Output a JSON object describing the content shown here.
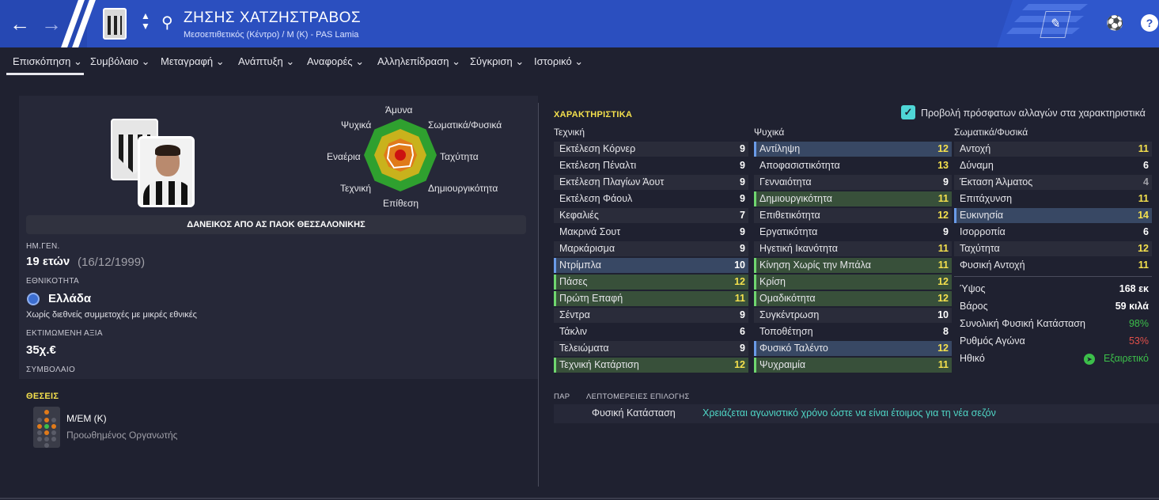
{
  "header": {
    "player_name": "ΖΗΣΗΣ ΧΑΤΖΗΣΤΡΑΒΟΣ",
    "player_sub": "Μεσοεπιθετικός (Κέντρο) / Μ (Κ) - PAS Lamia",
    "back_icon": "arrow-left-icon",
    "forward_icon": "arrow-right-icon",
    "search_icon": "search-icon",
    "help_label": "?"
  },
  "menu": {
    "items": [
      {
        "label": "Επισκόπηση"
      },
      {
        "label": "Συμβόλαιο"
      },
      {
        "label": "Μεταγραφή"
      },
      {
        "label": "Ανάπτυξη"
      },
      {
        "label": "Αναφορές"
      },
      {
        "label": "Αλληλεπίδραση"
      },
      {
        "label": "Σύγκριση"
      },
      {
        "label": "Ιστορικό"
      }
    ],
    "chevron": "⌄"
  },
  "radar": {
    "labels": [
      "Άμυνα",
      "Σωματικά/Φυσικά",
      "Ταχύτητα",
      "Δημιουργικότητα",
      "Επίθεση",
      "Τεχνική",
      "Εναέρια",
      "Ψυχικά"
    ],
    "colors": {
      "outer": "#2fa02f",
      "mid": "#c9b21c",
      "inner": "#e07a1a",
      "core": "#cc1111"
    }
  },
  "profile": {
    "loan_text": "ΔΑΝΕΙΚΟΣ ΑΠΟ ΑΣ ΠΑΟΚ ΘΕΣΣΑΛΟΝΙΚΗΣ",
    "dob_label": "ΗΜ.ΓΕΝ.",
    "age": "19 ετών",
    "dob": "(16/12/1999)",
    "nationality_label": "ΕΘΝΙΚΟΤΗΤΑ",
    "nationality": "Ελλάδα",
    "caps_note": "Χωρίς διεθνείς συμμετοχές με μικρές εθνικές",
    "value_label": "ΕΚΤΙΜΩΜΕΝΗ ΑΞΙΑ",
    "value": "35χ.€",
    "contract_label": "ΣΥΜΒΟΛΑΙΟ"
  },
  "positions": {
    "title": "ΘΕΣΕΙΣ",
    "position": "Μ/ΕΜ (Κ)",
    "role": "Προωθημένος Οργανωτής"
  },
  "attributes": {
    "title": "ΧΑΡΑΚΤΗΡΙΣΤΙΚΑ",
    "checkbox_label": "Προβολή πρόσφατων αλλαγών στα χαρακτηριστικά",
    "checkbox_mark": "✓",
    "col_technical": "Τεχνική",
    "col_mental": "Ψυχικά",
    "col_physical": "Σωματικά/Φυσικά",
    "technical": [
      {
        "name": "Εκτέλεση Κόρνερ",
        "value": "9",
        "hl": ""
      },
      {
        "name": "Εκτέλεση Πέναλτι",
        "value": "9",
        "hl": ""
      },
      {
        "name": "Εκτέλεση Πλαγίων Άουτ",
        "value": "9",
        "hl": ""
      },
      {
        "name": "Εκτέλεση Φάουλ",
        "value": "9",
        "hl": ""
      },
      {
        "name": "Κεφαλιές",
        "value": "7",
        "hl": ""
      },
      {
        "name": "Μακρινά Σουτ",
        "value": "9",
        "hl": ""
      },
      {
        "name": "Μαρκάρισμα",
        "value": "9",
        "hl": ""
      },
      {
        "name": "Ντρίμπλα",
        "value": "10",
        "hl": "blue"
      },
      {
        "name": "Πάσες",
        "value": "12",
        "hl": "green"
      },
      {
        "name": "Πρώτη Επαφή",
        "value": "11",
        "hl": "green"
      },
      {
        "name": "Σέντρα",
        "value": "9",
        "hl": ""
      },
      {
        "name": "Τάκλιν",
        "value": "6",
        "hl": ""
      },
      {
        "name": "Τελειώματα",
        "value": "9",
        "hl": ""
      },
      {
        "name": "Τεχνική Κατάρτιση",
        "value": "12",
        "hl": "green"
      }
    ],
    "mental": [
      {
        "name": "Αντίληψη",
        "value": "12",
        "hl": "blue"
      },
      {
        "name": "Αποφασιστικότητα",
        "value": "13",
        "hl": ""
      },
      {
        "name": "Γενναιότητα",
        "value": "9",
        "hl": ""
      },
      {
        "name": "Δημιουργικότητα",
        "value": "11",
        "hl": "green"
      },
      {
        "name": "Επιθετικότητα",
        "value": "12",
        "hl": ""
      },
      {
        "name": "Εργατικότητα",
        "value": "9",
        "hl": ""
      },
      {
        "name": "Ηγετική Ικανότητα",
        "value": "11",
        "hl": ""
      },
      {
        "name": "Κίνηση Χωρίς την Μπάλα",
        "value": "11",
        "hl": "green"
      },
      {
        "name": "Κρίση",
        "value": "12",
        "hl": "green"
      },
      {
        "name": "Ομαδικότητα",
        "value": "12",
        "hl": "green"
      },
      {
        "name": "Συγκέντρωση",
        "value": "10",
        "hl": ""
      },
      {
        "name": "Τοποθέτηση",
        "value": "8",
        "hl": ""
      },
      {
        "name": "Φυσικό Ταλέντο",
        "value": "12",
        "hl": "blue"
      },
      {
        "name": "Ψυχραιμία",
        "value": "11",
        "hl": "green"
      }
    ],
    "physical": [
      {
        "name": "Αντοχή",
        "value": "11",
        "hl": ""
      },
      {
        "name": "Δύναμη",
        "value": "6",
        "hl": ""
      },
      {
        "name": "Έκταση Άλματος",
        "value": "4",
        "hl": ""
      },
      {
        "name": "Επιτάχυνση",
        "value": "11",
        "hl": ""
      },
      {
        "name": "Ευκινησία",
        "value": "14",
        "hl": "blue"
      },
      {
        "name": "Ισορροπία",
        "value": "6",
        "hl": ""
      },
      {
        "name": "Ταχύτητα",
        "value": "12",
        "hl": ""
      },
      {
        "name": "Φυσική Αντοχή",
        "value": "11",
        "hl": ""
      }
    ],
    "stats": [
      {
        "name": "Ύψος",
        "value": "168 εκ"
      },
      {
        "name": "Βάρος",
        "value": "59 κιλά"
      },
      {
        "name": "Συνολική Φυσική Κατάσταση",
        "value": "98%"
      },
      {
        "name": "Ρυθμός Αγώνα",
        "value": "53%"
      },
      {
        "name": "Ηθικό",
        "value": "Εξαιρετικό"
      }
    ]
  },
  "selection": {
    "col1": "ΠΑΡ",
    "col2": "ΛΕΠΤΟΜΕΡΕΙΕΣ ΕΠΙΛΟΓΗΣ",
    "item_name": "Φυσική Κατάσταση",
    "item_detail": "Χρειάζεται αγωνιστικό χρόνο ώστε να είναι έτοιμος για τη νέα σεζόν"
  },
  "colors": {
    "header_blue": "#2b4fbf",
    "value_yellow": "#f4e04d",
    "value_white": "#ffffff",
    "value_gray": "#a0a0a8",
    "good_green": "#3cbf4a",
    "bad_red": "#e0504a",
    "teal_text": "#4fd6c6"
  }
}
